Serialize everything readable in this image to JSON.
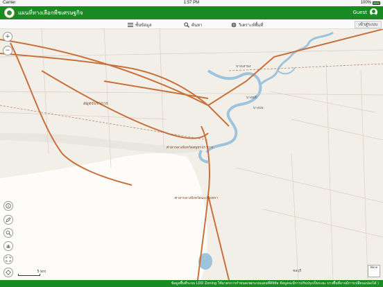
{
  "status_bar": {
    "carrier": "Carrier",
    "time": "1:57 PM",
    "battery": "100%",
    "battery_level": 1.0
  },
  "header": {
    "title": "แผนที่ทางเลือกพืชเศรษฐกิจ",
    "user": "Guest"
  },
  "toolbar": {
    "layers_label": "ชั้นข้อมูล",
    "search_label": "ค้นหา",
    "analyze_label": "วิเคราะห์พื้นที่",
    "login_label": "เข้าสู่ระบบ"
  },
  "map": {
    "places": [
      "สมุทรปราการ",
      "ศาลากลางจังหวัดสมุทรปราการ",
      "ศาลากลางจังหวัดฉะเชิงเทรา",
      "บางพลี",
      "บางบ่อ",
      "บางเสาธง",
      "ชลบุรี"
    ],
    "scale_label": "5 km",
    "minimap_label": "None"
  },
  "footer": {
    "notice": "ข้อมูลพื้นที่ระบบ LDD Zoning ใช้มาตรการกำหนดเขตระบบแผนที่ดิจิทัล ข้อมูลจะมีการปรับปรุงเป็นระยะ บางพื้นที่อาจมีการเปลี่ยนแปลงได้ )"
  },
  "colors": {
    "header_green": "#1a8a22",
    "road": "#c8703a",
    "water": "#9ec3dd",
    "land": "#f2efe9"
  }
}
